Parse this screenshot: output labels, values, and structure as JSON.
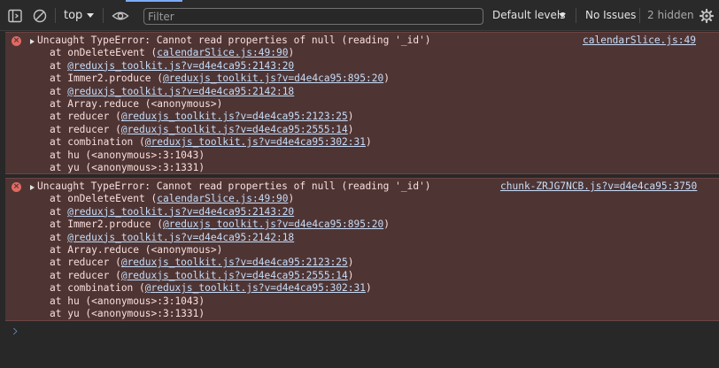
{
  "toolbar": {
    "context": "top",
    "filter_placeholder": "Filter",
    "levels": "Default levels",
    "issues": "No Issues",
    "hidden": "2 hidden"
  },
  "errors": [
    {
      "message": "Uncaught TypeError: Cannot read properties of null (reading '_id')",
      "source": "calendarSlice.js:49",
      "frames": [
        {
          "pre": "at onDeleteEvent (",
          "link": "calendarSlice.js:49:90",
          "post": ")"
        },
        {
          "pre": "at ",
          "link": "@reduxjs_toolkit.js?v=d4e4ca95:2143:20",
          "post": ""
        },
        {
          "pre": "at Immer2.produce (",
          "link": "@reduxjs_toolkit.js?v=d4e4ca95:895:20",
          "post": ")"
        },
        {
          "pre": "at ",
          "link": "@reduxjs_toolkit.js?v=d4e4ca95:2142:18",
          "post": ""
        },
        {
          "pre": "at Array.reduce (<anonymous>)",
          "link": "",
          "post": ""
        },
        {
          "pre": "at reducer (",
          "link": "@reduxjs_toolkit.js?v=d4e4ca95:2123:25",
          "post": ")"
        },
        {
          "pre": "at reducer (",
          "link": "@reduxjs_toolkit.js?v=d4e4ca95:2555:14",
          "post": ")"
        },
        {
          "pre": "at combination (",
          "link": "@reduxjs_toolkit.js?v=d4e4ca95:302:31",
          "post": ")"
        },
        {
          "pre": "at hu (<anonymous>:3:1043)",
          "link": "",
          "post": ""
        },
        {
          "pre": "at yu (<anonymous>:3:1331)",
          "link": "",
          "post": ""
        }
      ]
    },
    {
      "message": "Uncaught TypeError: Cannot read properties of null (reading '_id')",
      "source": "chunk-ZRJG7NCB.js?v=d4e4ca95:3750",
      "frames": [
        {
          "pre": "at onDeleteEvent (",
          "link": "calendarSlice.js:49:90",
          "post": ")"
        },
        {
          "pre": "at ",
          "link": "@reduxjs_toolkit.js?v=d4e4ca95:2143:20",
          "post": ""
        },
        {
          "pre": "at Immer2.produce (",
          "link": "@reduxjs_toolkit.js?v=d4e4ca95:895:20",
          "post": ")"
        },
        {
          "pre": "at ",
          "link": "@reduxjs_toolkit.js?v=d4e4ca95:2142:18",
          "post": ""
        },
        {
          "pre": "at Array.reduce (<anonymous>)",
          "link": "",
          "post": ""
        },
        {
          "pre": "at reducer (",
          "link": "@reduxjs_toolkit.js?v=d4e4ca95:2123:25",
          "post": ")"
        },
        {
          "pre": "at reducer (",
          "link": "@reduxjs_toolkit.js?v=d4e4ca95:2555:14",
          "post": ")"
        },
        {
          "pre": "at combination (",
          "link": "@reduxjs_toolkit.js?v=d4e4ca95:302:31",
          "post": ")"
        },
        {
          "pre": "at hu (<anonymous>:3:1043)",
          "link": "",
          "post": ""
        },
        {
          "pre": "at yu (<anonymous>:3:1331)",
          "link": "",
          "post": ""
        }
      ]
    }
  ]
}
